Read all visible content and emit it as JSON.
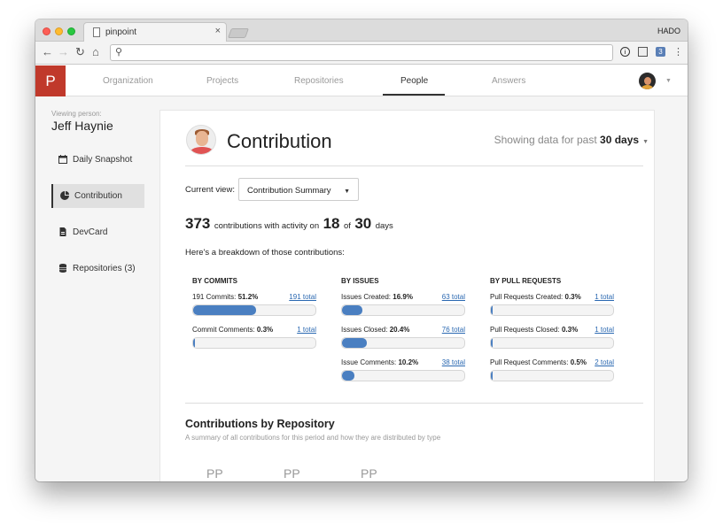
{
  "browser": {
    "tab_title": "pinpoint",
    "tab_close": "×",
    "profile": "HADO",
    "address_value": "",
    "ext_badge": "3"
  },
  "app": {
    "logo": "P",
    "nav": [
      "Organization",
      "Projects",
      "Repositories",
      "People",
      "Answers"
    ],
    "active_nav": "People",
    "brand_color": "#c0392b"
  },
  "sidebar": {
    "viewing_label": "Viewing person:",
    "person_name": "Jeff Haynie",
    "items": [
      {
        "label": "Daily Snapshot",
        "icon": "calendar-icon"
      },
      {
        "label": "Contribution",
        "icon": "pie-chart-icon",
        "active": true
      },
      {
        "label": "DevCard",
        "icon": "document-icon"
      },
      {
        "label": "Repositories (3)",
        "icon": "database-icon"
      }
    ]
  },
  "main": {
    "title": "Contribution",
    "showing_prefix": "Showing data for past",
    "showing_period": "30 days",
    "current_view_label": "Current view:",
    "current_view_value": "Contribution Summary",
    "contrib_count": "373",
    "contrib_text": "contributions with activity on",
    "active_days": "18",
    "of_text": "of",
    "total_days": "30",
    "days_text": "days",
    "breakdown_text": "Here's a breakdown of those contributions:",
    "columns": [
      {
        "heading": "BY COMMITS",
        "metrics": [
          {
            "label": "191 Commits:",
            "pct": "51.2%",
            "total": "191 total",
            "fill": 0.512
          },
          {
            "label": "Commit Comments:",
            "pct": "0.3%",
            "total": "1 total",
            "fill": 0.003
          }
        ]
      },
      {
        "heading": "BY ISSUES",
        "metrics": [
          {
            "label": "Issues Created:",
            "pct": "16.9%",
            "total": "63 total",
            "fill": 0.169
          },
          {
            "label": "Issues Closed:",
            "pct": "20.4%",
            "total": "76 total",
            "fill": 0.204
          },
          {
            "label": "Issue Comments:",
            "pct": "10.2%",
            "total": "38 total",
            "fill": 0.102
          }
        ]
      },
      {
        "heading": "BY PULL REQUESTS",
        "metrics": [
          {
            "label": "Pull Requests Created:",
            "pct": "0.3%",
            "total": "1 total",
            "fill": 0.003
          },
          {
            "label": "Pull Requests Closed:",
            "pct": "0.3%",
            "total": "1 total",
            "fill": 0.003
          },
          {
            "label": "Pull Request Comments:",
            "pct": "0.5%",
            "total": "2 total",
            "fill": 0.005
          }
        ]
      }
    ],
    "repo_section_title": "Contributions by Repository",
    "repo_section_sub": "A summary of all contributions for this period and how they are distributed by type",
    "repo_badges": [
      "PP",
      "PP",
      "PP"
    ],
    "bar_color": "#4a7fc1"
  }
}
